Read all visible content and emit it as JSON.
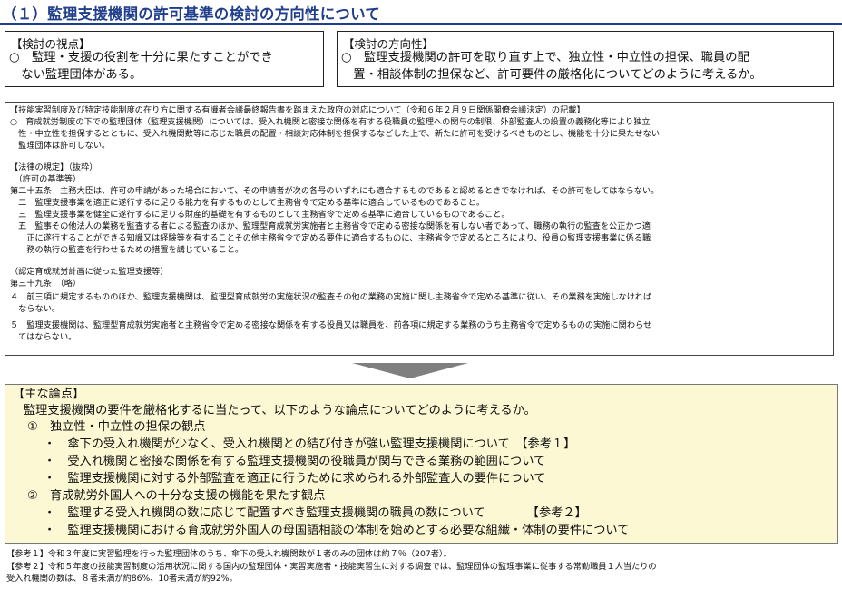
{
  "title": "（１）監理支援機関の許可基準の検討の方向性について",
  "viewpoint": {
    "heading": "【検討の視点】",
    "lines": [
      "○　監理・支援の役割を十分に果たすことができ",
      "　ない監理団体がある。"
    ]
  },
  "direction": {
    "heading": "【検討の方向性】",
    "lines": [
      "○　監理支援機関の許可を取り直す上で、独立性・中立性の担保、職員の配",
      "　置・相談体制の担保など、許可要件の厳格化についてどのように考えるか。"
    ]
  },
  "legal": {
    "lines": [
      "【技能実習制度及び特定技能制度の在り方に関する有識者会議最終報告書を踏まえた政府の対応について（令和６年２月９日関係閣僚会議決定）の記載】",
      "○　育成就労制度の下での監理団体（監理支援機関）については、受入れ機関と密接な関係を有する役職員の監理への関与の制限、外部監査人の設置の義務化等により独立",
      "　性・中立性を担保するとともに、受入れ機関数等に応じた職員の配置・相談対応体制を担保するなどした上で、新たに許可を受けるべきものとし、機能を十分に果たせない",
      "　監理団体は許可しない。",
      "【法律の規定】（抜粋）",
      "　（許可の基準等）",
      "第二十五条　主務大臣は、許可の申請があった場合において、その申請者が次の各号のいずれにも適合するものであると認めるときでなければ、その許可をしてはならない。",
      "　二　監理支援事業を適正に遂行するに足りる能力を有するものとして主務省令で定める基準に適合しているものであること。",
      "　三　監理支援事業を健全に遂行するに足りる財産的基礎を有するものとして主務省令で定める基準に適合しているものであること。",
      "　五　監事その他法人の業務を監査する者による監査のほか、監理型育成就労実施者と主務省令で定める密接な関係を有しない者であって、職務の執行の監査を公正かつ適",
      "　　正に遂行することができる知識又は経験等を有することその他主務省令で定める要件に適合するものに、主務省令で定めるところにより、役員の監理支援事業に係る職",
      "　　務の執行の監査を行わせるための措置を講じていること。",
      "（認定育成就労計画に従った監理支援等）",
      "第三十九条　（略）",
      "４　前三項に規定するもののほか、監理支援機関は、監理型育成就労の実施状況の監査その他の業務の実施に関し主務省令で定める基準に従い、その業務を実施しなければ",
      "　ならない。",
      "５　監理支援機関は、監理型育成就労実施者と主務省令で定める密接な関係を有する役員又は職員を、前各項に規定する業務のうち主務省令で定めるものの実施に関わらせ",
      "　てはならない。"
    ]
  },
  "issues": {
    "heading": "【主な論点】",
    "intro": "監理支援機関の要件を厳格化するに当たって、以下のような論点についてどのように考えるか。",
    "point1": "①　独立性・中立性の担保の観点",
    "point1_items": [
      "・　傘下の受入れ機関が少なく、受入れ機関との結び付きが強い監理支援機関について　【参考１】",
      "・　受入れ機関と密接な関係を有する監理支援機関の役職員が関与できる業務の範囲について",
      "・　監理支援機関に対する外部監査を適正に行うために求められる外部監査人の要件について"
    ],
    "point2": "②　育成就労外国人への十分な支援の機能を果たす観点",
    "point2_items": [
      "・　監理する受入れ機関の数に応じて配置すべき監理支援機関の職員の数について　　　　【参考２】",
      "・　監理支援機関における育成就労外国人の母国語相談の体制を始めとする必要な組織・体制の要件について"
    ]
  },
  "notes": [
    "【参考１】令和３年度に実習監理を行った監理団体のうち、傘下の受入れ機関数が１者のみの団体は約７％（207者）。",
    "【参考２】令和５年度の技能実習制度の活用状況に関する国内の監理団体・実習実施者・技能実習生に対する調査では、監理団体の監理事業に従事する常勤職員１人当たりの",
    "受入れ機関の数は、８者未満が約86%、10者未満が約92%。"
  ],
  "colors": {
    "title": "#1f3e8c",
    "issues_bg": "#fdf8d4",
    "arrow": "#7f7f7f"
  }
}
